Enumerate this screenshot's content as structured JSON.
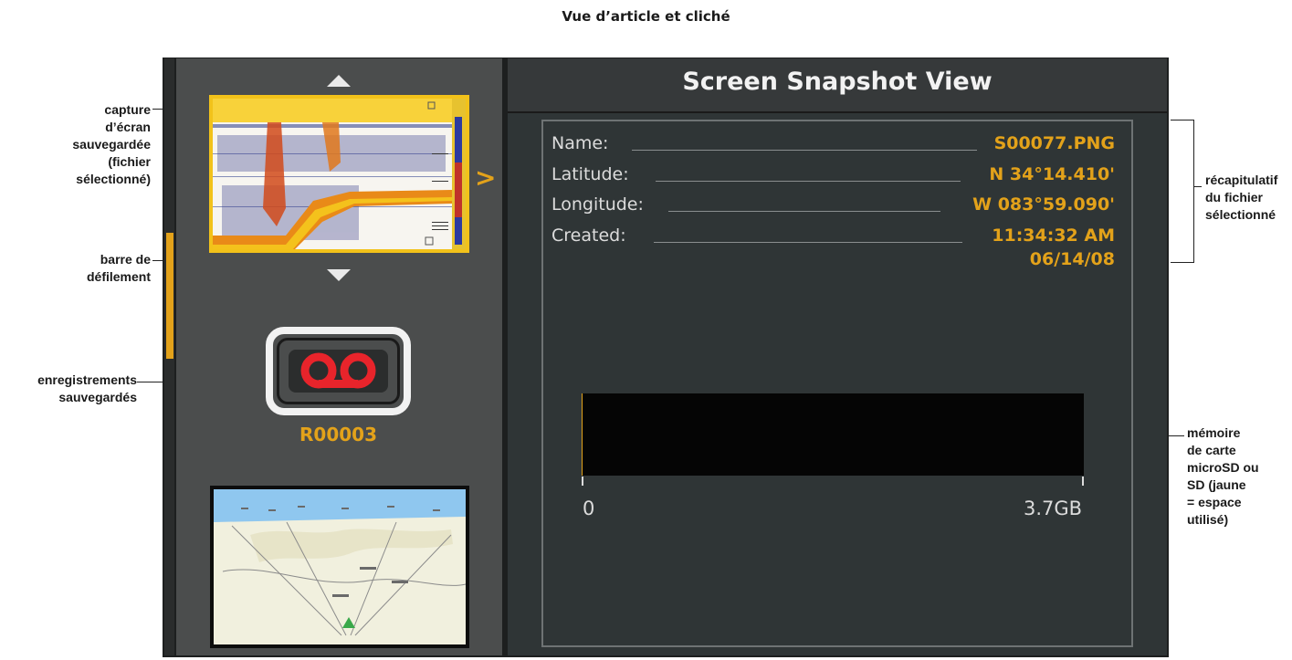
{
  "page_title": "Vue d’article et cliché",
  "callouts": {
    "capture": [
      "capture",
      "d’écran",
      "sauvegardée",
      "(fichier",
      "sélectionné)"
    ],
    "scrollbar": [
      "barre de",
      "défilement"
    ],
    "recordings": [
      "enregistrements",
      "sauvegardés"
    ],
    "summary": [
      "récapitulatif",
      "du fichier",
      "sélectionné"
    ],
    "memory": [
      "mémoire",
      "de carte",
      "microSD ou",
      "SD (jaune",
      "= espace",
      "utilisé)"
    ]
  },
  "left_panel": {
    "recording_label": "R00003",
    "selected_arrow": ">"
  },
  "main": {
    "title": "Screen Snapshot View",
    "fields": [
      {
        "label": "Name:",
        "value": "S00077.PNG"
      },
      {
        "label": "Latitude:",
        "value": "N 34°14.410'"
      },
      {
        "label": "Longitude:",
        "value": "W 083°59.090'"
      },
      {
        "label": "Created:",
        "value": "11:34:32 AM",
        "value2": "06/14/08"
      }
    ],
    "memory": {
      "min_label": "0",
      "max_label": "3.7GB",
      "used_fraction": 0.002,
      "used_color": "#e3a21a"
    }
  },
  "colors": {
    "accent": "#e3a21a",
    "panel_dark": "#2f3536",
    "panel_left": "#4b4d4d",
    "record_icon": "#e8242b"
  }
}
